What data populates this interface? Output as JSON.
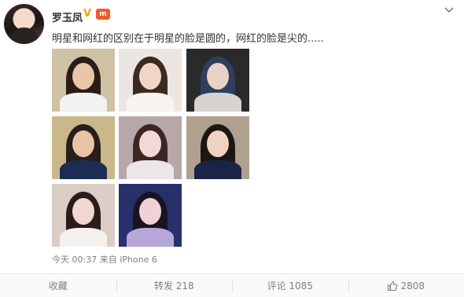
{
  "post": {
    "username": "罗玉凤",
    "verified_badge": "V",
    "member_badge": "m",
    "text": "明星和网红的区别在于明星的脸是圆的，网红的脸是尖的.....",
    "time": "今天 00:37",
    "source_prefix": "来自",
    "source": "iPhone 6"
  },
  "actions": {
    "favorite": "收藏",
    "repost": "转发 218",
    "comment": "评论 1085",
    "like": "2808"
  },
  "photos": [
    {
      "name": "photo-1",
      "bg": "#cfc2a5",
      "hair": "#2b1d16",
      "face": "#e9c6a9",
      "body": "#f2f2f2"
    },
    {
      "name": "photo-2",
      "bg": "#ece6e2",
      "hair": "#3a2a22",
      "face": "#f1d6c8",
      "body": "#f7f3ee"
    },
    {
      "name": "photo-3",
      "bg": "#2a2a2a",
      "hair": "#2f3f5e",
      "face": "#e8d2c6",
      "body": "#d8d2d0"
    },
    {
      "name": "photo-4",
      "bg": "#c9b98a",
      "hair": "#2a1e1a",
      "face": "#e7c3a8",
      "body": "#1d2c52"
    },
    {
      "name": "photo-5",
      "bg": "#b8a7a8",
      "hair": "#3a2624",
      "face": "#f3d9d4",
      "body": "#ece6ea"
    },
    {
      "name": "photo-6",
      "bg": "#b0a08e",
      "hair": "#1e1612",
      "face": "#f0d2c0",
      "body": "#1a2448"
    },
    {
      "name": "photo-7",
      "bg": "#d9cdc6",
      "hair": "#2a1c19",
      "face": "#f1d8cf",
      "body": "#f4f0ee"
    },
    {
      "name": "photo-8",
      "bg": "#27306a",
      "hair": "#1b1420",
      "face": "#efd1d6",
      "body": "#b7a6d8"
    }
  ]
}
